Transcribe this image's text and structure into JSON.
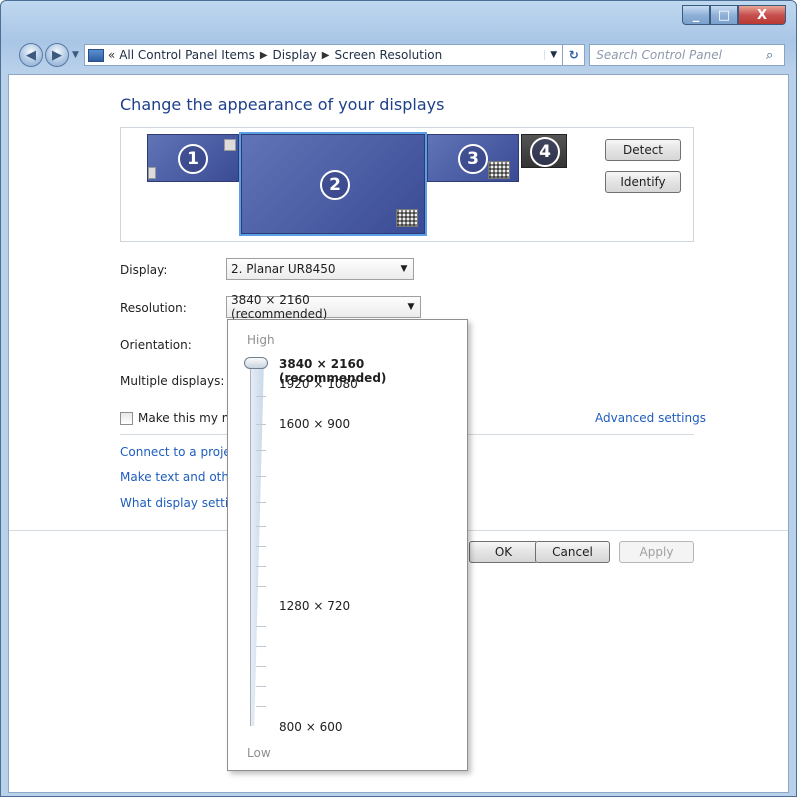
{
  "window": {
    "buttons": {
      "minimize": "_",
      "maximize": "□",
      "close": "X"
    }
  },
  "nav": {
    "back_icon": "back-arrow-icon",
    "forward_icon": "forward-arrow-icon",
    "address": {
      "overflow": "«",
      "crumbs": [
        "All Control Panel Items",
        "Display",
        "Screen Resolution"
      ]
    },
    "search_placeholder": "Search Control Panel"
  },
  "page": {
    "heading": "Change the appearance of your displays",
    "monitors": [
      "1",
      "2",
      "3",
      "4"
    ],
    "detect_label": "Detect",
    "identify_label": "Identify",
    "display_label": "Display:",
    "display_value": "2. Planar UR8450",
    "resolution_label": "Resolution:",
    "resolution_value": "3840 × 2160 (recommended)",
    "orientation_label": "Orientation:",
    "multiple_label": "Multiple displays:",
    "main_display_label": "Make this my ma",
    "advanced_link": "Advanced settings",
    "link_projector": "Connect to a projec",
    "link_text_size": "Make text and othe",
    "link_what_settings": "What display setting",
    "ok_label": "OK",
    "cancel_label": "Cancel",
    "apply_label": "Apply"
  },
  "resolution_popup": {
    "high_label": "High",
    "low_label": "Low",
    "options": [
      {
        "label": "3840 × 2160 (recommended)",
        "selected": true
      },
      {
        "label": "1920 × 1080",
        "selected": false
      },
      {
        "label": "1600 × 900",
        "selected": false
      },
      {
        "label": "1280 × 720",
        "selected": false
      },
      {
        "label": "800 × 600",
        "selected": false
      }
    ]
  },
  "colors": {
    "heading": "#1e3f8c",
    "link": "#1e5dbd",
    "monitor": "#4a5ca3"
  }
}
